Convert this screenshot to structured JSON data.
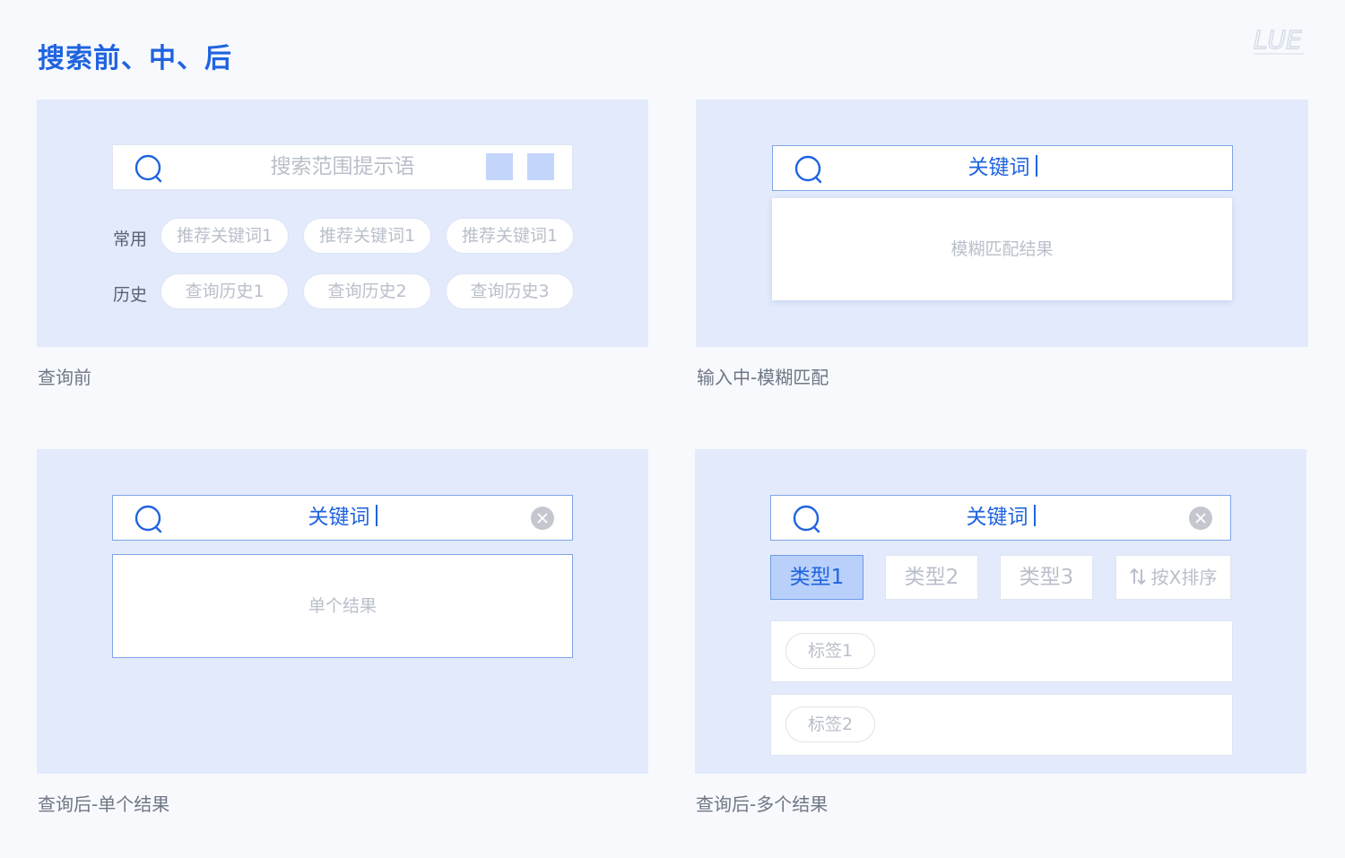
{
  "page": {
    "title": "搜索前、中、后",
    "logo_text": "LUE"
  },
  "colors": {
    "accent": "#1f63e0",
    "panel": "#e2eafc",
    "placeholder": "#b9bfca",
    "caption": "#6f7785"
  },
  "before": {
    "caption": "查询前",
    "placeholder": "搜索范围提示语",
    "common_label": "常用",
    "common_chips": [
      "推荐关键词1",
      "推荐关键词1",
      "推荐关键词1"
    ],
    "history_label": "历史",
    "history_chips": [
      "查询历史1",
      "查询历史2",
      "查询历史3"
    ]
  },
  "typing": {
    "caption": "输入中-模糊匹配",
    "keyword": "关键词",
    "result_text": "模糊匹配结果"
  },
  "single": {
    "caption": "查询后-单个结果",
    "keyword": "关键词",
    "result_text": "单个结果"
  },
  "multi": {
    "caption": "查询后-多个结果",
    "keyword": "关键词",
    "types": [
      "类型1",
      "类型2",
      "类型3"
    ],
    "sort_label": "按X排序",
    "tags": [
      "标签1",
      "标签2"
    ]
  }
}
